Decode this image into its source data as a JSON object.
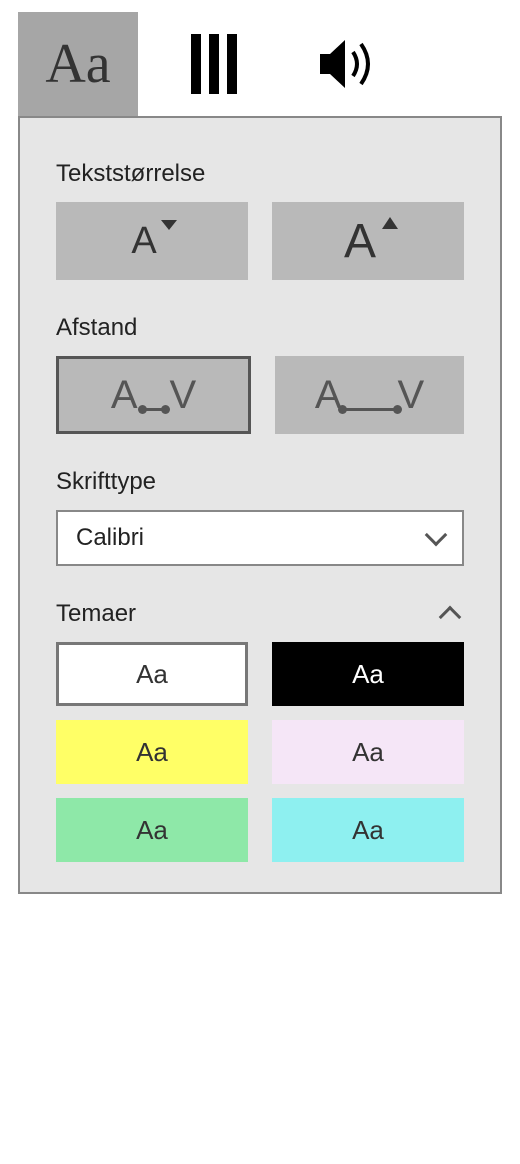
{
  "tabs": {
    "text_glyph": "Aa"
  },
  "sections": {
    "text_size": {
      "label": "Tekststørrelse"
    },
    "spacing": {
      "label": "Afstand"
    },
    "font": {
      "label": "Skrifttype",
      "selected": "Calibri"
    },
    "themes": {
      "label": "Temaer"
    }
  },
  "themes": [
    {
      "bg": "#ffffff",
      "fg": "#333333",
      "glyph": "Aa",
      "selected": true
    },
    {
      "bg": "#000000",
      "fg": "#ffffff",
      "glyph": "Aa",
      "selected": false
    },
    {
      "bg": "#ffff66",
      "fg": "#333333",
      "glyph": "Aa",
      "selected": false
    },
    {
      "bg": "#f5e6f7",
      "fg": "#333333",
      "glyph": "Aa",
      "selected": false
    },
    {
      "bg": "#8ee8a8",
      "fg": "#333333",
      "glyph": "Aa",
      "selected": false
    },
    {
      "bg": "#8ef0f0",
      "fg": "#333333",
      "glyph": "Aa",
      "selected": false
    }
  ]
}
